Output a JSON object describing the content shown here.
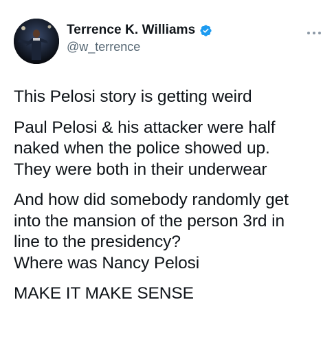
{
  "author": {
    "display_name": "Terrence K. Williams",
    "handle": "@w_terrence",
    "verified_icon": "verified-badge-icon",
    "avatar_icon": "profile-avatar"
  },
  "menu": {
    "icon": "more-options-icon"
  },
  "tweet": {
    "line1": "This Pelosi story is getting weird",
    "para2": {
      "line1": "Paul Pelosi & his attacker were half",
      "line2": "naked when the police showed up.",
      "line3": "They were both in their underwear"
    },
    "para3": {
      "line1": "And how did somebody randomly get",
      "line2": "into the mansion of the person 3rd in",
      "line3": "line to the presidency?",
      "line4": "Where was Nancy Pelosi"
    },
    "line_last": "MAKE IT MAKE SENSE"
  },
  "colors": {
    "text": "#0f1419",
    "secondary": "#536471",
    "verified": "#1d9bf0"
  }
}
